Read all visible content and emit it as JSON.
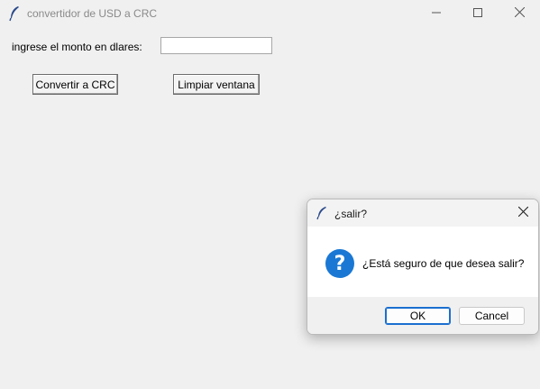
{
  "window": {
    "title": "convertidor de USD a CRC",
    "minimize_icon": "minimize-icon",
    "maximize_icon": "maximize-icon",
    "close_icon": "close-icon"
  },
  "form": {
    "amount_label": "ingrese el monto en dlares:",
    "amount_value": "",
    "convert_button": "Convertir a CRC",
    "clear_button": "Limpiar ventana"
  },
  "dialog": {
    "title": "¿salir?",
    "message": "¿Está seguro de que desea salir?",
    "icon": "question-icon",
    "question_glyph": "?",
    "ok_button": "OK",
    "cancel_button": "Cancel"
  },
  "colors": {
    "window_bg": "#f0f0f0",
    "accent": "#1a78d4"
  }
}
